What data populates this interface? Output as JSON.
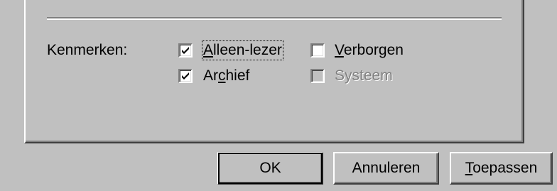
{
  "attributes": {
    "label": "Kenmerken:",
    "items": [
      {
        "label_prefix": "",
        "label_mnemonic": "A",
        "label_rest": "lleen-lezer",
        "checked": true,
        "enabled": true,
        "focused": true
      },
      {
        "label_prefix": "",
        "label_mnemonic": "V",
        "label_rest": "erborgen",
        "checked": false,
        "enabled": true,
        "focused": false
      },
      {
        "label_prefix": "Ar",
        "label_mnemonic": "c",
        "label_rest": "hief",
        "checked": true,
        "enabled": true,
        "focused": false
      },
      {
        "label_prefix": "",
        "label_mnemonic": "",
        "label_rest": "Systeem",
        "checked": false,
        "enabled": false,
        "focused": false
      }
    ]
  },
  "buttons": {
    "ok": {
      "label": "OK"
    },
    "cancel": {
      "label": "Annuleren"
    },
    "apply": {
      "label_mnemonic": "T",
      "label_rest": "oepassen"
    }
  },
  "colors": {
    "face": "#c0c0c0",
    "highlight": "#ffffff",
    "shadow": "#808080",
    "dark_shadow": "#404040",
    "disabled_text": "#808080"
  }
}
